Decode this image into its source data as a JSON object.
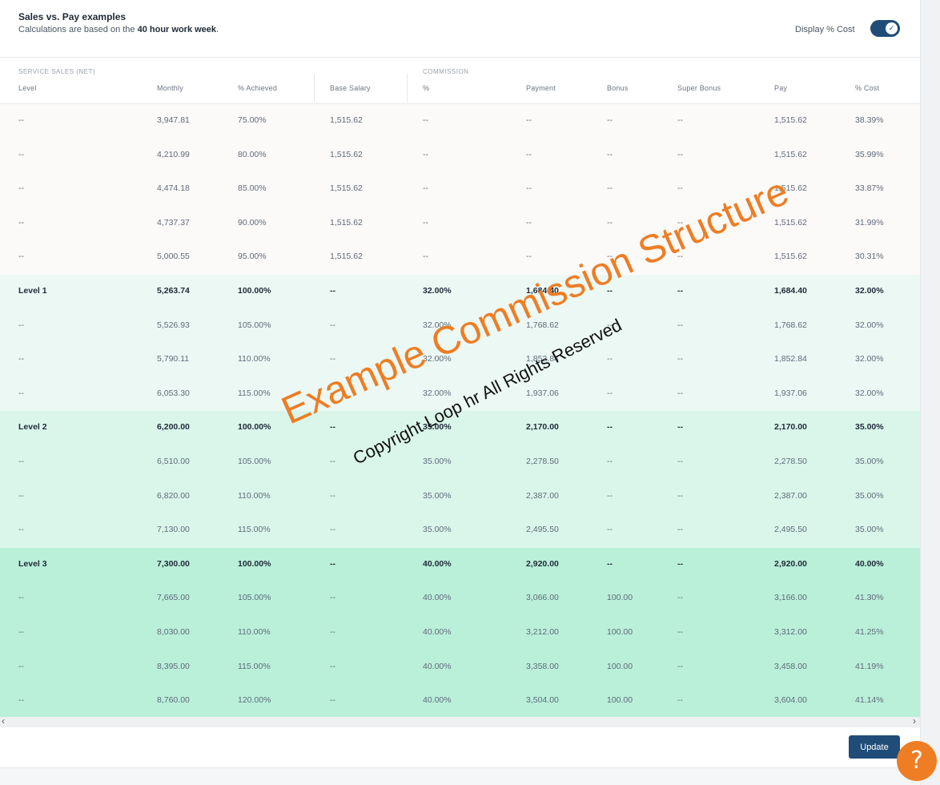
{
  "header": {
    "title": "Sales vs. Pay examples",
    "subtitle_prefix": "Calculations are based on the ",
    "subtitle_bold": "40 hour work week",
    "subtitle_suffix": ".",
    "toggle_label": "Display % Cost",
    "toggle_on": true
  },
  "groups": {
    "service_sales": "SERVICE SALES (NET)",
    "commission": "COMMISSION"
  },
  "columns": [
    "Level",
    "Monthly",
    "% Achieved",
    "Base Salary",
    "%",
    "Payment",
    "Bonus",
    "Super Bonus",
    "Pay",
    "% Cost"
  ],
  "colors": {
    "accent": "#1f4d78",
    "watermark": "#ee7d23",
    "band_base": "#fcf9f9",
    "band_level1": "#ecf8f4",
    "band_level2": "#daf6eb",
    "band_level3": "#baefda"
  },
  "rows": [
    {
      "band": "base",
      "cells": [
        "--",
        "3,947.81",
        "75.00%",
        "1,515.62",
        "--",
        "--",
        "--",
        "--",
        "1,515.62",
        "38.39%"
      ]
    },
    {
      "band": "base",
      "cells": [
        "--",
        "4,210.99",
        "80.00%",
        "1,515.62",
        "--",
        "--",
        "--",
        "--",
        "1,515.62",
        "35.99%"
      ]
    },
    {
      "band": "base",
      "cells": [
        "--",
        "4,474.18",
        "85.00%",
        "1,515.62",
        "--",
        "--",
        "--",
        "--",
        "1,515.62",
        "33.87%"
      ]
    },
    {
      "band": "base",
      "cells": [
        "--",
        "4,737.37",
        "90.00%",
        "1,515.62",
        "--",
        "--",
        "--",
        "--",
        "1,515.62",
        "31.99%"
      ]
    },
    {
      "band": "base",
      "cells": [
        "--",
        "5,000.55",
        "95.00%",
        "1,515.62",
        "--",
        "--",
        "--",
        "--",
        "1,515.62",
        "30.31%"
      ]
    },
    {
      "band": "level1",
      "level": true,
      "cells": [
        "Level 1",
        "5,263.74",
        "100.00%",
        "--",
        "32.00%",
        "1,684.40",
        "--",
        "--",
        "1,684.40",
        "32.00%"
      ]
    },
    {
      "band": "level1",
      "cells": [
        "--",
        "5,526.93",
        "105.00%",
        "--",
        "32.00%",
        "1,768.62",
        "--",
        "--",
        "1,768.62",
        "32.00%"
      ]
    },
    {
      "band": "level1",
      "cells": [
        "--",
        "5,790.11",
        "110.00%",
        "--",
        "32.00%",
        "1,852.84",
        "--",
        "--",
        "1,852.84",
        "32.00%"
      ]
    },
    {
      "band": "level1",
      "cells": [
        "--",
        "6,053.30",
        "115.00%",
        "--",
        "32.00%",
        "1,937.06",
        "--",
        "--",
        "1,937.06",
        "32.00%"
      ]
    },
    {
      "band": "level2",
      "level": true,
      "cells": [
        "Level 2",
        "6,200.00",
        "100.00%",
        "--",
        "35.00%",
        "2,170.00",
        "--",
        "--",
        "2,170.00",
        "35.00%"
      ]
    },
    {
      "band": "level2",
      "cells": [
        "--",
        "6,510.00",
        "105.00%",
        "--",
        "35.00%",
        "2,278.50",
        "--",
        "--",
        "2,278.50",
        "35.00%"
      ]
    },
    {
      "band": "level2",
      "cells": [
        "--",
        "6,820.00",
        "110.00%",
        "--",
        "35.00%",
        "2,387.00",
        "--",
        "--",
        "2,387.00",
        "35.00%"
      ]
    },
    {
      "band": "level2",
      "cells": [
        "--",
        "7,130.00",
        "115.00%",
        "--",
        "35.00%",
        "2,495.50",
        "--",
        "--",
        "2,495.50",
        "35.00%"
      ]
    },
    {
      "band": "level3",
      "level": true,
      "cells": [
        "Level 3",
        "7,300.00",
        "100.00%",
        "--",
        "40.00%",
        "2,920.00",
        "--",
        "--",
        "2,920.00",
        "40.00%"
      ]
    },
    {
      "band": "level3",
      "cells": [
        "--",
        "7,665.00",
        "105.00%",
        "--",
        "40.00%",
        "3,066.00",
        "100.00",
        "--",
        "3,166.00",
        "41.30%"
      ]
    },
    {
      "band": "level3",
      "cells": [
        "--",
        "8,030.00",
        "110.00%",
        "--",
        "40.00%",
        "3,212.00",
        "100.00",
        "--",
        "3,312.00",
        "41.25%"
      ]
    },
    {
      "band": "level3",
      "cells": [
        "--",
        "8,395.00",
        "115.00%",
        "--",
        "40.00%",
        "3,358.00",
        "100.00",
        "--",
        "3,458.00",
        "41.19%"
      ]
    },
    {
      "band": "level3",
      "cells": [
        "--",
        "8,760.00",
        "120.00%",
        "--",
        "40.00%",
        "3,504.00",
        "100.00",
        "--",
        "3,604.00",
        "41.14%"
      ]
    }
  ],
  "watermark": {
    "main": "Example Commission Structure",
    "copyright": "Copyright Loop hr All Rights Reserved"
  },
  "footer": {
    "update_label": "Update",
    "help_glyph": "?"
  },
  "scroll": {
    "left_arrow": "‹",
    "right_arrow": "›"
  }
}
